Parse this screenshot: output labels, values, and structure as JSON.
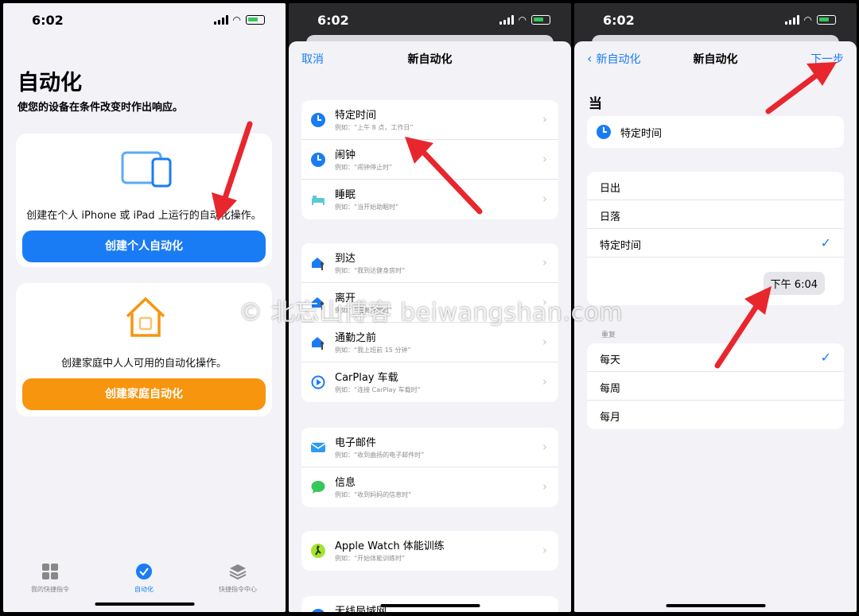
{
  "status": {
    "time": "6:02"
  },
  "panel1": {
    "title": "自动化",
    "subtitle": "使您的设备在条件改变时作出响应。",
    "personal": {
      "desc": "创建在个人 iPhone 或 iPad 上运行的自动化操作。",
      "button": "创建个人自动化",
      "color": "#1a7cf5"
    },
    "home": {
      "desc": "创建家庭中人人可用的自动化操作。",
      "button": "创建家庭自动化",
      "color": "#f7950f"
    },
    "tabs": [
      {
        "label": "我的快捷指令",
        "icon": "grid-icon"
      },
      {
        "label": "自动化",
        "icon": "automation-icon",
        "active": true
      },
      {
        "label": "快捷指令中心",
        "icon": "layers-icon"
      }
    ]
  },
  "panel2": {
    "nav": {
      "left": "取消",
      "title": "新自动化"
    },
    "groups": [
      [
        {
          "title": "特定时间",
          "sub": "例如：“上午 8 点，工作日”",
          "icon": "clock-icon"
        },
        {
          "title": "闹钟",
          "sub": "例如：“闹钟停止时”",
          "icon": "clock-icon"
        },
        {
          "title": "睡眠",
          "sub": "例如：“当开始助眠时”",
          "icon": "bed-icon"
        }
      ],
      [
        {
          "title": "到达",
          "sub": "例如：“我到达健身房时”",
          "icon": "house-person-icon"
        },
        {
          "title": "离开",
          "sub": "例如：“我离开家时”",
          "icon": "house-person-icon"
        },
        {
          "title": "通勤之前",
          "sub": "例如：“我上班前 15 分钟”",
          "icon": "house-person-icon"
        },
        {
          "title": "CarPlay 车载",
          "sub": "例如：“连接 CarPlay 车载时”",
          "icon": "carplay-icon"
        }
      ],
      [
        {
          "title": "电子邮件",
          "sub": "例如：“收到曲扬的电子邮件时”",
          "icon": "mail-icon"
        },
        {
          "title": "信息",
          "sub": "例如：“收到妈妈的信息时”",
          "icon": "message-icon"
        }
      ],
      [
        {
          "title": "Apple Watch 体能训练",
          "sub": "例如：“开始体能训练时”",
          "icon": "workout-icon"
        }
      ],
      [
        {
          "title": "无线局域网",
          "sub": "",
          "icon": "wifi-icon"
        }
      ]
    ]
  },
  "panel3": {
    "nav": {
      "back": "新自动化",
      "title": "新自动化",
      "next": "下一步"
    },
    "when_label": "当",
    "trigger": "特定时间",
    "options": [
      {
        "label": "日出",
        "checked": false
      },
      {
        "label": "日落",
        "checked": false
      },
      {
        "label": "特定时间",
        "checked": true
      }
    ],
    "time_value": "下午 6:04",
    "repeat_header": "重复",
    "repeat": [
      {
        "label": "每天",
        "checked": true
      },
      {
        "label": "每周",
        "checked": false
      },
      {
        "label": "每月",
        "checked": false
      }
    ]
  },
  "watermark": "© 北忘山博客 beiwangshan.com"
}
